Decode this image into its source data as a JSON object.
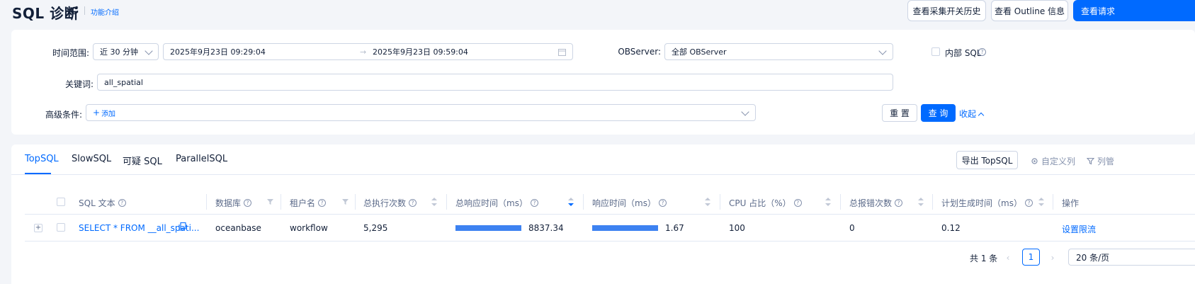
{
  "header": {
    "title": "SQL 诊断",
    "feature_link": "功能介绍",
    "buttons": {
      "switch_history": "查看采集开关历史",
      "outline_info": "查看 Outline 信息",
      "view_requests": "查看请求"
    }
  },
  "filters": {
    "time_range_label": "时间范围:",
    "time_range_value": "近 30 分钟",
    "start_time": "2025年9月23日 09:29:04",
    "end_time": "2025年9月23日 09:59:04",
    "range_separator": "→",
    "observer_label": "OBServer:",
    "observer_value": "全部 OBServer",
    "internal_sql_label": "内部 SQL",
    "keyword_label": "关键词:",
    "keyword_value": "all_spatial",
    "advanced_label": "高级条件:",
    "add_label": "添加",
    "reset_label": "重 置",
    "query_label": "查 询",
    "collapse_label": "收起"
  },
  "tabs": [
    {
      "label": "TopSQL",
      "active": true
    },
    {
      "label": "SlowSQL",
      "active": false
    },
    {
      "label": "可疑 SQL",
      "active": false
    },
    {
      "label": "ParallelSQL",
      "active": false
    }
  ],
  "toolbar": {
    "export_label": "导出 TopSQL",
    "custom_columns_label": "自定义列",
    "column_manage_label": "列管"
  },
  "table": {
    "columns": [
      "SQL 文本",
      "数据库",
      "租户名",
      "总执行次数",
      "总响应时间（ms）",
      "响应时间（ms）",
      "CPU 占比（%）",
      "总报错次数",
      "计划生成时间（ms）",
      "操作"
    ],
    "rows": [
      {
        "sql_text": "SELECT * FROM __all_spati...",
        "database": "oceanbase",
        "tenant": "workflow",
        "exec_count": "5,295",
        "total_response": "8837.34",
        "total_response_fraction": 1.0,
        "response": "1.67",
        "response_fraction": 1.0,
        "cpu_ratio": "100",
        "error_count": "0",
        "plan_time": "0.12",
        "action": "设置限流"
      }
    ]
  },
  "pagination": {
    "total": "共 1 条",
    "current_page": "1",
    "page_size": "20 条/页"
  },
  "colors": {
    "primary": "#006aff",
    "bar": "#3d82f1"
  }
}
